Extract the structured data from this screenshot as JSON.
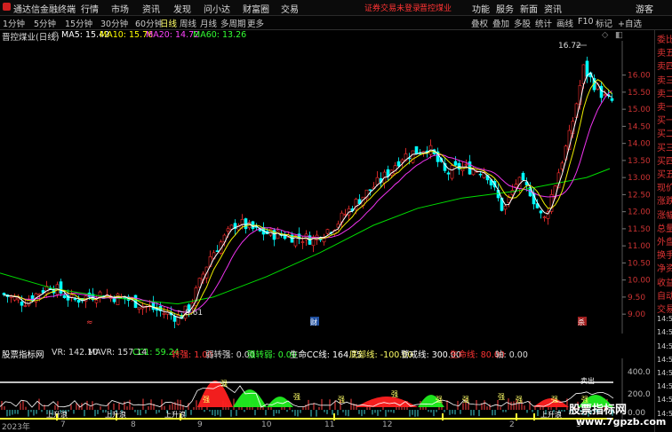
{
  "app": {
    "title": "通达信金融终端"
  },
  "menu": [
    "行情",
    "市场",
    "资讯",
    "发现",
    "问小达",
    "财富圈",
    "交易"
  ],
  "login_notice": "证券交易未登录",
  "stock_name_top": "晋控煤业",
  "top_right": [
    "功能",
    "服务",
    "新面",
    "资讯",
    "游客"
  ],
  "periods": [
    "1分钟",
    "5分钟",
    "15分钟",
    "30分钟",
    "60分钟",
    "日线",
    "周线",
    "月线",
    "多周期",
    "更多"
  ],
  "active_period": "日线",
  "tools": [
    "叠权",
    "叠加",
    "多股",
    "统计",
    "画线",
    "F10",
    "标记",
    "+自选"
  ],
  "ma": {
    "title": "晋控煤业(日线)",
    "ma5": "MA5: 15.42",
    "ma10": "MA10: 15.76",
    "ma20": "MA20: 14.72",
    "ma60": "MA60: 13.26"
  },
  "colors": {
    "ma5": "#ffffff",
    "ma10": "#ffff00",
    "ma20": "#ff00ff",
    "ma60": "#00ff00",
    "up": "#ff3030",
    "down": "#00ffff"
  },
  "price_axis": [
    "16.00",
    "15.50",
    "15.00",
    "14.50",
    "14.00",
    "13.50",
    "13.00",
    "12.50",
    "12.00",
    "11.50",
    "11.00",
    "10.50",
    "10.00",
    "9.50",
    "9.00"
  ],
  "price_high_label": "16.72",
  "price_low_label": "8.61",
  "event_marks": [
    "≈",
    "财",
    "杀"
  ],
  "indicator": {
    "name": "股票指标网",
    "vr": "VR: 142.10",
    "mavr": "MAVR: 157.14",
    "cc1": "CC1: 59.24",
    "zq": "转强: 1.00",
    "rzq": "弱转强: 0.00",
    "qzr": "强转弱: 0.00",
    "smcc": "生命CC线: 164.75",
    "dbx": "底部线: -100.00",
    "jjx": "警戒线: 300.00",
    "smx": "生命线: 80.00",
    "zhou": "轴: 0.00"
  },
  "ind_axis": [
    "400.0",
    "200.0",
    "0.00"
  ],
  "ind_labels": [
    "上升浪",
    "上升浪",
    "上升浪",
    "上升浪",
    "卖出",
    "强",
    "强",
    "强",
    "强",
    "强",
    "强",
    "强",
    "强",
    "强",
    "强",
    "强"
  ],
  "right_panel": [
    "委比",
    "卖五",
    "卖四",
    "卖三",
    "卖二",
    "卖一",
    "买一",
    "买二",
    "买三",
    "买四",
    "买五",
    "现价",
    "涨跌",
    "涨幅",
    "总量",
    "外盘",
    "换手",
    "净资",
    "收益",
    "自动",
    "交易",
    "14:50",
    "14:50",
    "14:50",
    "14:50",
    "14:50",
    "14:50",
    "14:50",
    "14:50"
  ],
  "dates": [
    "2023年",
    "7",
    "8",
    "9",
    "10",
    "11",
    "12",
    "2",
    "3"
  ],
  "watermark": {
    "line1": "股票指标网",
    "line2": "www.7gpzb.com"
  }
}
